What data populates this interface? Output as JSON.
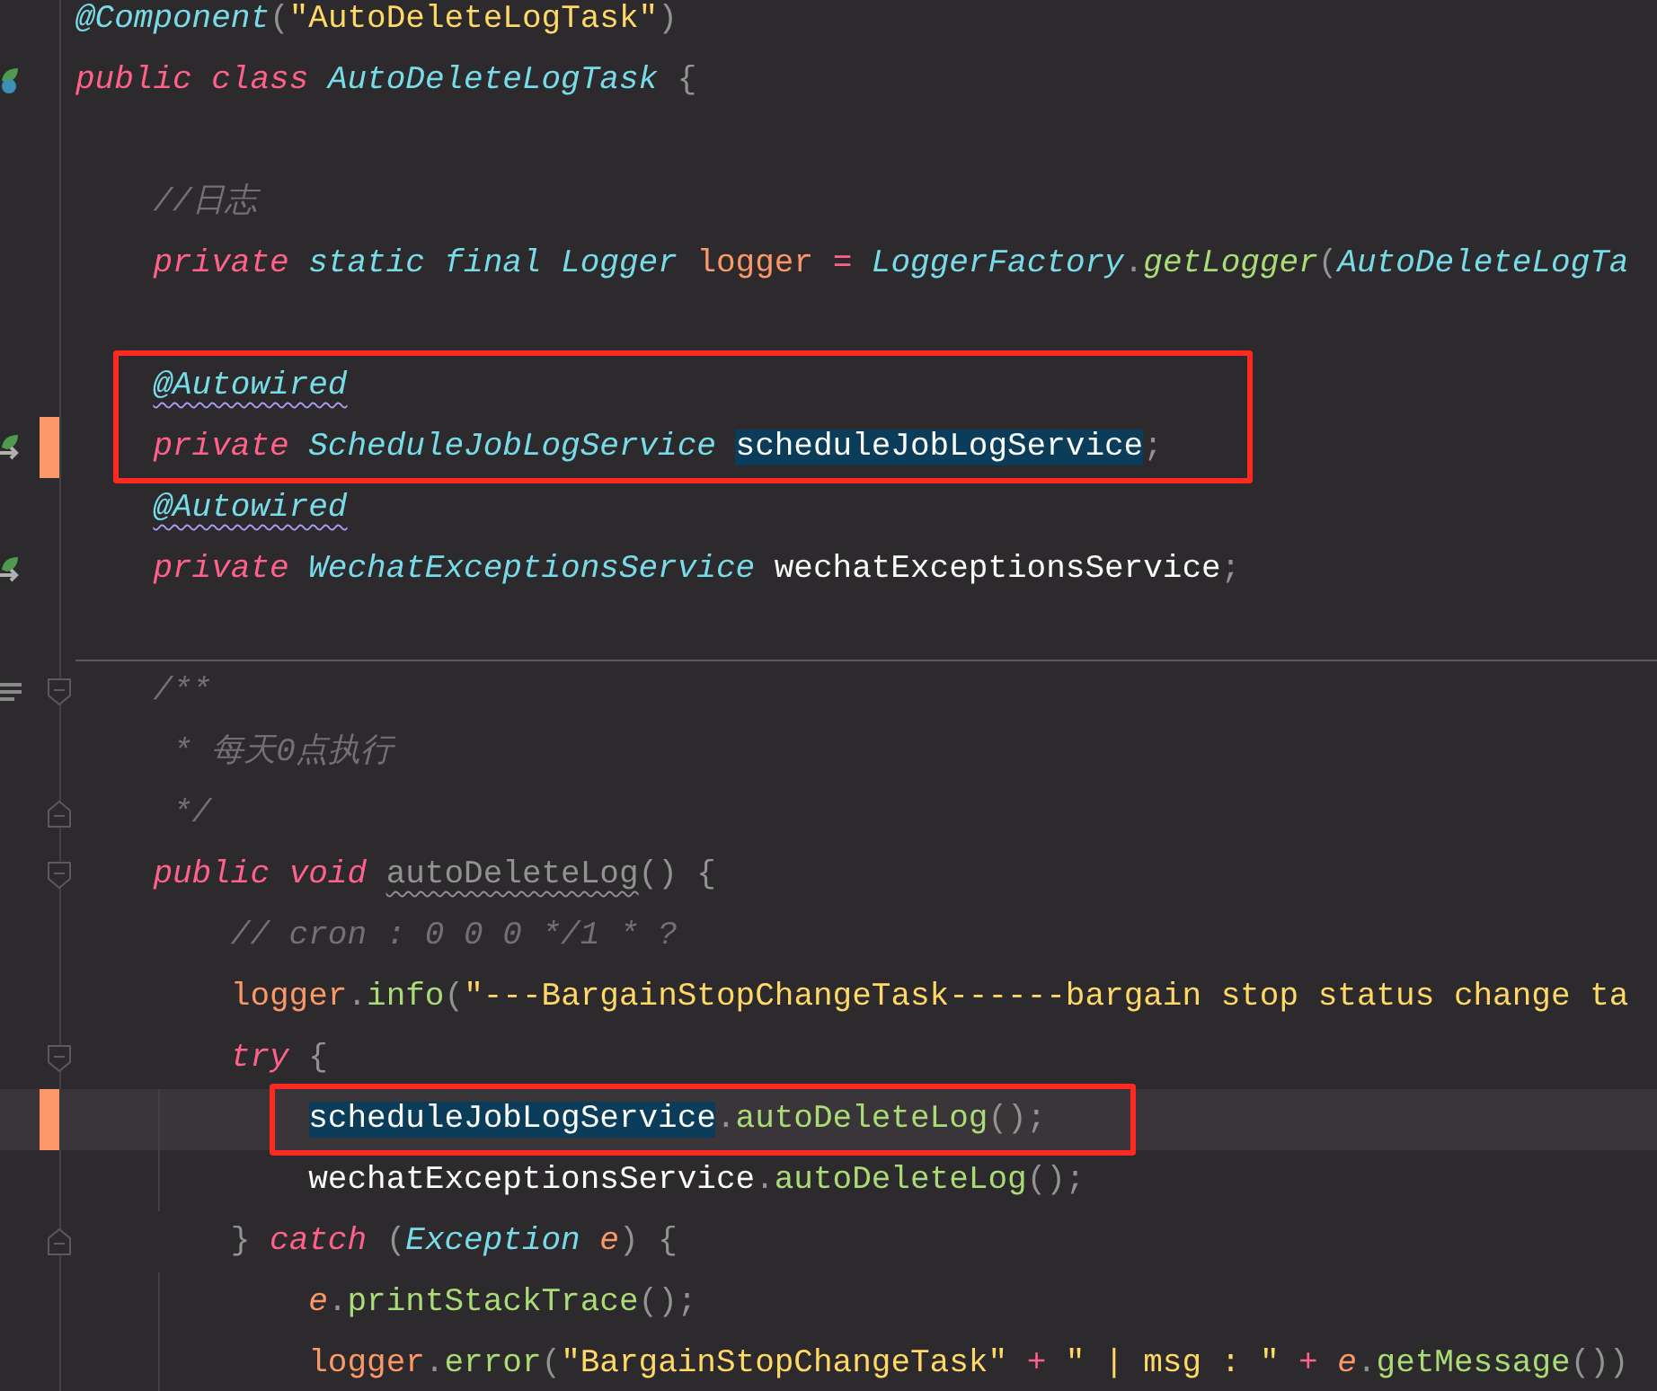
{
  "lines": [
    {
      "kind": "code",
      "tokens": [
        {
          "text": "@Component",
          "kind": "annotation"
        },
        {
          "text": "(",
          "kind": "punct"
        },
        {
          "text": "\"AutoDeleteLogTask\"",
          "kind": "string"
        },
        {
          "text": ")",
          "kind": "punct"
        }
      ]
    },
    {
      "kind": "code",
      "gutter_icon": {
        "kind": "bean_class"
      },
      "tokens": [
        {
          "text": "public class ",
          "kind": "keyword"
        },
        {
          "text": "AutoDeleteLogTask",
          "kind": "type"
        },
        {
          "text": " {",
          "kind": "punct"
        }
      ],
      "children": [
        {
          "kind": "blank"
        },
        {
          "kind": "code",
          "tokens": [
            {
              "text": "//日志",
              "kind": "comment"
            }
          ]
        },
        {
          "kind": "code",
          "tokens": [
            {
              "text": "private ",
              "kind": "keyword"
            },
            {
              "text": "static final ",
              "kind": "modifier"
            },
            {
              "text": "Logger ",
              "kind": "type"
            },
            {
              "text": "logger ",
              "kind": "field"
            },
            {
              "text": "= ",
              "kind": "operator"
            },
            {
              "text": "LoggerFactory",
              "kind": "type"
            },
            {
              "text": ".",
              "kind": "punct"
            },
            {
              "text": "getLogger",
              "kind": "static_method"
            },
            {
              "text": "(",
              "kind": "punct"
            },
            {
              "text": "AutoDeleteLogTa",
              "kind": "type"
            }
          ]
        },
        {
          "kind": "blank"
        },
        {
          "kind": "code",
          "boxed": true,
          "tokens": [
            {
              "text": "@Autowired",
              "kind": "annotation",
              "warning": true
            }
          ]
        },
        {
          "kind": "code",
          "boxed": true,
          "changed": true,
          "gutter_icon": {
            "kind": "bean_injection"
          },
          "tokens": [
            {
              "text": "private ",
              "kind": "keyword"
            },
            {
              "text": "ScheduleJobLogService ",
              "kind": "type"
            },
            {
              "text": "scheduleJobLogService",
              "kind": "plain",
              "selected": true
            },
            {
              "text": ";",
              "kind": "punct"
            }
          ]
        },
        {
          "kind": "code",
          "tokens": [
            {
              "text": "@Autowired",
              "kind": "annotation",
              "warning": true
            }
          ]
        },
        {
          "kind": "code",
          "gutter_icon": {
            "kind": "bean_injection"
          },
          "tokens": [
            {
              "text": "private ",
              "kind": "keyword"
            },
            {
              "text": "WechatExceptionsService ",
              "kind": "type"
            },
            {
              "text": "wechatExceptionsService",
              "kind": "plain"
            },
            {
              "text": ";",
              "kind": "punct"
            }
          ]
        },
        {
          "kind": "blank"
        },
        {
          "kind": "code",
          "separator_above": true,
          "fold": {
            "kind": "start"
          },
          "gutter_icon": {
            "kind": "doc_render"
          },
          "tokens": [
            {
              "text": "/**",
              "kind": "comment"
            }
          ]
        },
        {
          "kind": "doc_body",
          "tokens": [
            {
              "text": "* 每天0点执行",
              "kind": "comment"
            }
          ]
        },
        {
          "kind": "doc_body",
          "fold": {
            "kind": "end"
          },
          "tokens": [
            {
              "text": "*/",
              "kind": "comment"
            }
          ]
        },
        {
          "kind": "code",
          "fold": {
            "kind": "start"
          },
          "tokens": [
            {
              "text": "public void ",
              "kind": "keyword"
            },
            {
              "text": "autoDeleteLog",
              "kind": "unused",
              "warning": true
            },
            {
              "text": "() {",
              "kind": "punct"
            }
          ],
          "children": [
            {
              "kind": "code",
              "tokens": [
                {
                  "text": "// cron : 0 0 0 */1 * ?",
                  "kind": "comment"
                }
              ]
            },
            {
              "kind": "code",
              "tokens": [
                {
                  "text": "logger",
                  "kind": "field"
                },
                {
                  "text": ".",
                  "kind": "punct"
                },
                {
                  "text": "info",
                  "kind": "method"
                },
                {
                  "text": "(",
                  "kind": "punct"
                },
                {
                  "text": "\"---BargainStopChangeTask------bargain stop status change ta",
                  "kind": "string"
                }
              ]
            },
            {
              "kind": "code",
              "fold": {
                "kind": "start"
              },
              "tokens": [
                {
                  "text": "try",
                  "kind": "keyword"
                },
                {
                  "text": " {",
                  "kind": "punct"
                }
              ],
              "children": [
                {
                  "kind": "code",
                  "boxed": true,
                  "changed": true,
                  "current": true,
                  "tokens": [
                    {
                      "text": "scheduleJobLogService",
                      "kind": "plain",
                      "selected": true
                    },
                    {
                      "text": ".",
                      "kind": "punct"
                    },
                    {
                      "text": "autoDeleteLog",
                      "kind": "method"
                    },
                    {
                      "text": "();",
                      "kind": "punct"
                    }
                  ]
                },
                {
                  "kind": "code",
                  "tokens": [
                    {
                      "text": "wechatExceptionsService",
                      "kind": "plain"
                    },
                    {
                      "text": ".",
                      "kind": "punct"
                    },
                    {
                      "text": "autoDeleteLog",
                      "kind": "method"
                    },
                    {
                      "text": "();",
                      "kind": "punct"
                    }
                  ]
                }
              ]
            },
            {
              "kind": "code",
              "fold": {
                "kind": "end"
              },
              "tokens": [
                {
                  "text": "} ",
                  "kind": "punct"
                },
                {
                  "text": "catch",
                  "kind": "keyword"
                },
                {
                  "text": " (",
                  "kind": "punct"
                },
                {
                  "text": "Exception ",
                  "kind": "type"
                },
                {
                  "text": "e",
                  "kind": "param"
                },
                {
                  "text": ") {",
                  "kind": "punct"
                }
              ],
              "children": [
                {
                  "kind": "code",
                  "tokens": [
                    {
                      "text": "e",
                      "kind": "param"
                    },
                    {
                      "text": ".",
                      "kind": "punct"
                    },
                    {
                      "text": "printStackTrace",
                      "kind": "method"
                    },
                    {
                      "text": "();",
                      "kind": "punct"
                    }
                  ]
                },
                {
                  "kind": "code",
                  "tokens": [
                    {
                      "text": "logger",
                      "kind": "field"
                    },
                    {
                      "text": ".",
                      "kind": "punct"
                    },
                    {
                      "text": "error",
                      "kind": "method"
                    },
                    {
                      "text": "(",
                      "kind": "punct"
                    },
                    {
                      "text": "\"BargainStopChangeTask\"",
                      "kind": "string"
                    },
                    {
                      "text": " + ",
                      "kind": "operator"
                    },
                    {
                      "text": "\" | msg : \"",
                      "kind": "string"
                    },
                    {
                      "text": " + ",
                      "kind": "operator"
                    },
                    {
                      "text": "e",
                      "kind": "param"
                    },
                    {
                      "text": ".",
                      "kind": "punct"
                    },
                    {
                      "text": "getMessage",
                      "kind": "method"
                    },
                    {
                      "text": "())",
                      "kind": "punct"
                    }
                  ]
                }
              ]
            }
          ]
        }
      ]
    }
  ]
}
